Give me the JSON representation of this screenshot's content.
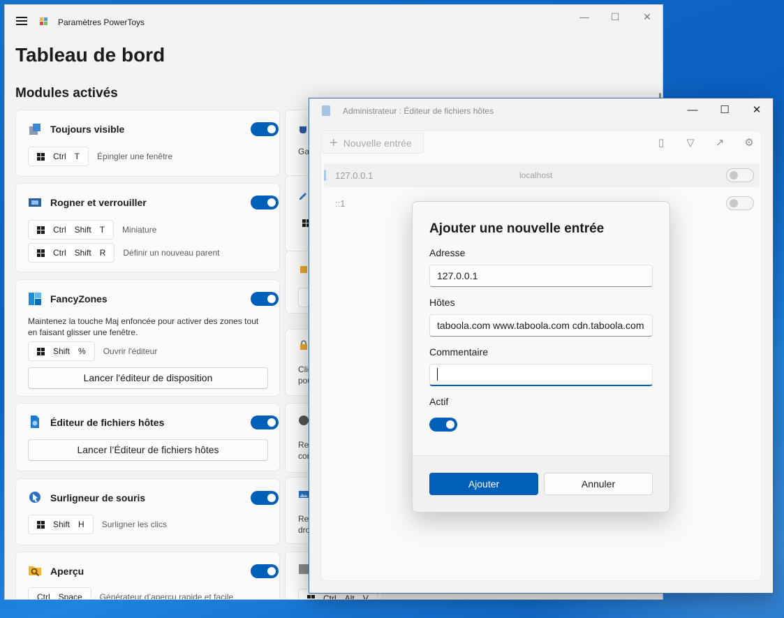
{
  "powertoys": {
    "title": "Paramètres PowerToys",
    "page_title": "Tableau de bord",
    "section_title": "Modules activés",
    "modules": {
      "always_on_top": {
        "title": "Toujours visible",
        "enabled": true,
        "shortcut_keys": [
          "Ctrl",
          "T"
        ],
        "shortcut_desc": "Épingler une fenêtre"
      },
      "crop_and_lock": {
        "title": "Rogner et verrouiller",
        "enabled": true,
        "shortcuts": [
          {
            "keys": [
              "Ctrl",
              "Shift",
              "T"
            ],
            "desc": "Miniature"
          },
          {
            "keys": [
              "Ctrl",
              "Shift",
              "R"
            ],
            "desc": "Définir un nouveau parent"
          }
        ]
      },
      "fancyzones": {
        "title": "FancyZones",
        "enabled": true,
        "description": "Maintenez la touche Maj enfoncée pour activer des zones tout en faisant glisser une fenêtre.",
        "shortcut_keys": [
          "Shift",
          "%"
        ],
        "shortcut_desc": "Ouvrir l'éditeur",
        "button": "Lancer l'éditeur de disposition"
      },
      "hosts_editor": {
        "title": "Éditeur de fichiers hôtes",
        "enabled": true,
        "button": "Lancer l’Éditeur de fichiers hôtes"
      },
      "mouse_highlighter": {
        "title": "Surligneur de souris",
        "enabled": true,
        "shortcut_keys": [
          "Shift",
          "H"
        ],
        "shortcut_desc": "Surligner les clics"
      },
      "peek": {
        "title": "Aperçu",
        "enabled": true,
        "shortcut_keys": [
          "Ctrl",
          "Space"
        ],
        "shortcut_desc": "Générateur d’aperçu rapide et facile"
      }
    },
    "col2_fragments": {
      "c1": "Gar",
      "c3a": "Clic",
      "c3b": "pou",
      "c4a": "Rec",
      "c4b": "con",
      "c5a": "Rec",
      "c5b": "dro",
      "c6_keys": [
        "Ctrl",
        "Alt",
        "V"
      ]
    },
    "colors": {
      "accent": "#005fb8",
      "background": "#f3f3f3"
    }
  },
  "hosts": {
    "title": "Administrateur : Éditeur de fichiers hôtes",
    "new_entry_label": "Nouvelle entrée",
    "entries": [
      {
        "address": "127.0.0.1",
        "hosts": "localhost",
        "active": false
      },
      {
        "address": "::1",
        "hosts": "",
        "active": false
      }
    ]
  },
  "dialog": {
    "title": "Ajouter une nouvelle entrée",
    "address_label": "Adresse",
    "address_value": "127.0.0.1",
    "hosts_label": "Hôtes",
    "hosts_value": "taboola.com www.taboola.com cdn.taboola.com",
    "comment_label": "Commentaire",
    "comment_value": "",
    "active_label": "Actif",
    "active": true,
    "add_button": "Ajouter",
    "cancel_button": "Annuler"
  }
}
